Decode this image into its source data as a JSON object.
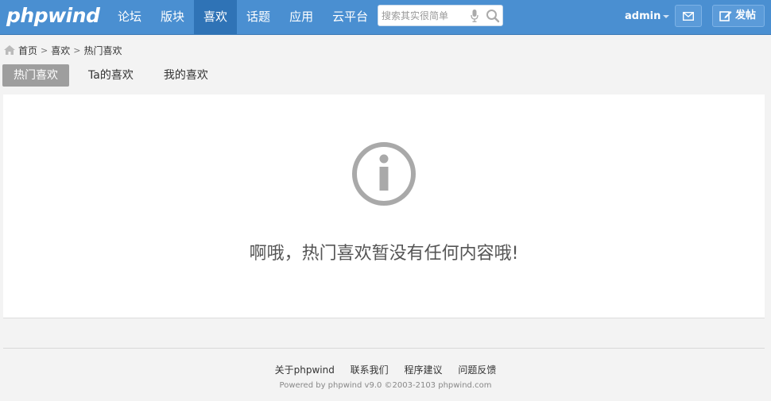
{
  "header": {
    "logo": "phpwind",
    "nav": [
      {
        "label": "论坛",
        "active": false
      },
      {
        "label": "版块",
        "active": false
      },
      {
        "label": "喜欢",
        "active": true
      },
      {
        "label": "话题",
        "active": false
      },
      {
        "label": "应用",
        "active": false
      },
      {
        "label": "云平台",
        "active": false
      }
    ],
    "search_placeholder": "搜索其实很简单",
    "username": "admin",
    "post_label": "发帖",
    "accent_color": "#4a8fd1"
  },
  "breadcrumb": [
    "首页",
    "喜欢",
    "热门喜欢"
  ],
  "tabs": [
    {
      "label": "热门喜欢",
      "active": true
    },
    {
      "label": "Ta的喜欢",
      "active": false
    },
    {
      "label": "我的喜欢",
      "active": false
    }
  ],
  "main": {
    "icon": "info-icon",
    "empty_message": "啊哦，热门喜欢暂没有任何内容哦!"
  },
  "footer": {
    "links": [
      "关于phpwind",
      "联系我们",
      "程序建议",
      "问题反馈"
    ],
    "powered": "Powered by phpwind v9.0 ©2003-2103 phpwind.com"
  }
}
